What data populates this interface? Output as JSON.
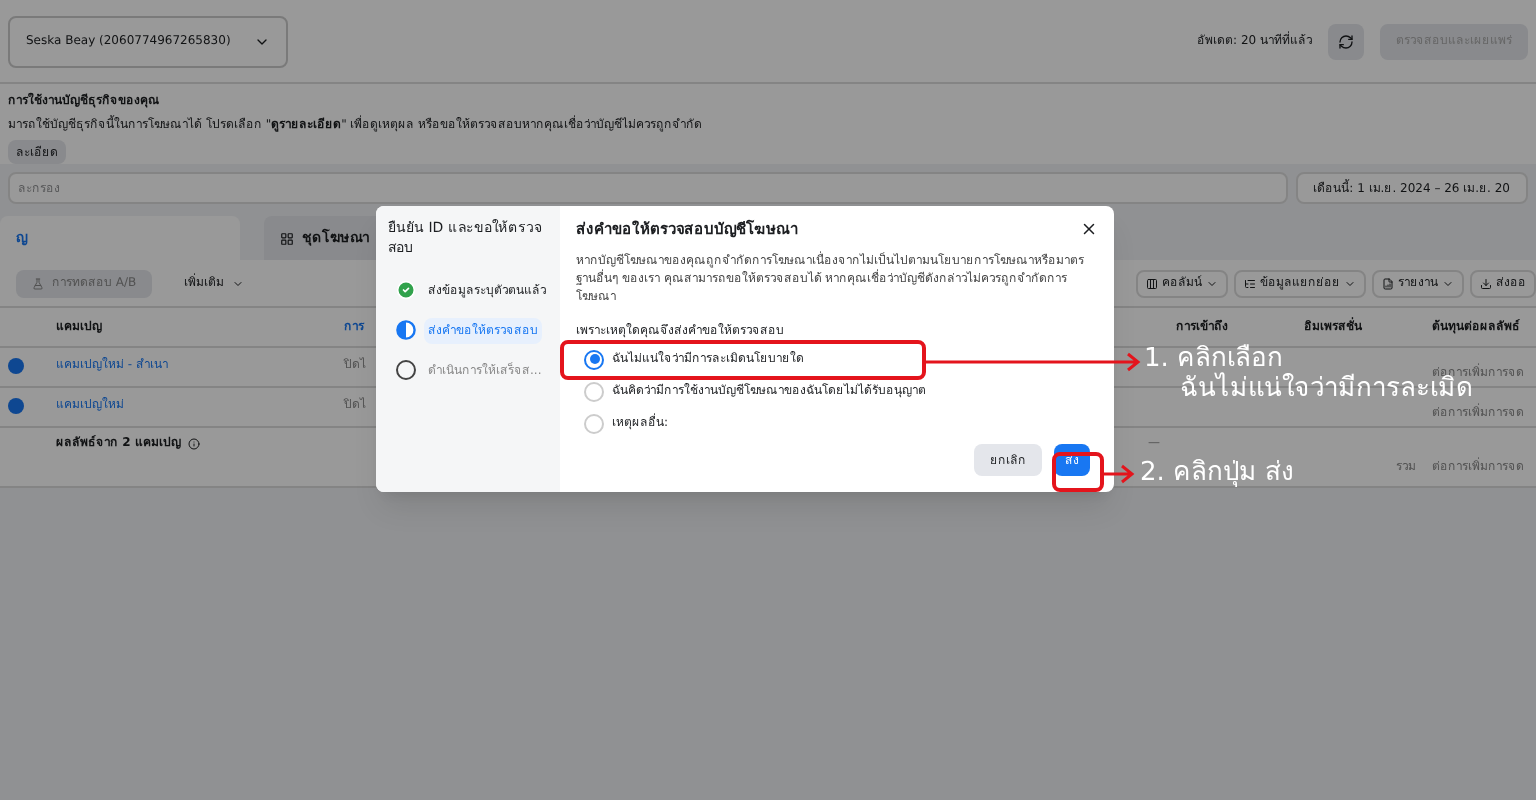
{
  "topbar": {
    "account": "Seska Beay (2060774967265830)",
    "updated": "อัพเดต: 20 นาทีที่แล้ว",
    "publish_button": "ตรวจสอบและเผยแพร่"
  },
  "banner": {
    "title": "การใช้งานบัญชีธุรกิจของคุณ",
    "text": "มารถใช้บัญชีธุรกิจนี้ในการโฆษณาได้ โปรดเลือก \"**ดูรายละเอียด**\" เพื่อดูเหตุผล หรือขอให้ตรวจสอบหากคุณเชื่อว่าบัญชีไม่ควรถูกจำกัด",
    "button": "ละเอียด"
  },
  "filter": {
    "placeholder": "ละกรอง",
    "date": "เดือนนี้: 1 เม.ย. 2024 – 26 เม.ย. 20"
  },
  "tabs": [
    {
      "label": "ญ",
      "selected": true
    },
    {
      "label": "ชุดโฆษณา",
      "selected": false
    }
  ],
  "toolbar_left": [
    "การทดสอบ A/B",
    "เพิ่มเติม"
  ],
  "toolbar_right": [
    "คอลัมน์",
    "ข้อมูลแยกย่อย",
    "รายงาน",
    "ส่งออ"
  ],
  "table": {
    "columns": [
      "แคมเปญ",
      "การ",
      "การเข้าถึง",
      "อิมเพรสชั่น",
      "ต้นทุนต่อผลลัพธ์"
    ],
    "rows": [
      {
        "name": "แคมเปญใหม่ - สำเนา",
        "status": "ปิดไ",
        "cost": "ต่อการเพิ่มการจด"
      },
      {
        "name": "แคมเปญใหม่",
        "status": "ปิดไ",
        "cost": "ต่อการเพิ่มการจด"
      }
    ],
    "footer": "ผลลัพธ์จาก 2 แคมเปญ",
    "footer_cells": [
      "—",
      "รวม",
      "ต่อการเพิ่มการจด"
    ]
  },
  "dialog": {
    "steps_title": "ยืนยัน ID และขอให้ตรวจสอบ",
    "steps": [
      {
        "label": "ส่งข้อมูลระบุตัวตนแล้ว",
        "kind": "done",
        "selected": false
      },
      {
        "label": "ส่งคำขอให้ตรวจสอบ",
        "kind": "current",
        "selected": true
      },
      {
        "label": "ดำเนินการให้เสร็จส...",
        "kind": "todo",
        "selected": false
      }
    ],
    "title": "ส่งคำขอให้ตรวจสอบบัญชีโฆษณา",
    "description": "หากบัญชีโฆษณาของคุณถูกจำกัดการโฆษณาเนื่องจากไม่เป็นไปตามนโยบายการโฆษณาหรือมาตรฐานอื่นๆ ของเรา คุณสามารถขอให้ตรวจสอบได้ หากคุณเชื่อว่าบัญชีดังกล่าวไม่ควรถูกจำกัดการโฆษณา",
    "question": "เพราะเหตุใดคุณจึงส่งคำขอให้ตรวจสอบ",
    "options": [
      {
        "label": "ฉันไม่แน่ใจว่ามีการละเมิดนโยบายใด",
        "selected": true
      },
      {
        "label": "ฉันคิดว่ามีการใช้งานบัญชีโฆษณาของฉันโดยไม่ได้รับอนุญาต",
        "selected": false
      },
      {
        "label": "เหตุผลอื่น:",
        "selected": false
      }
    ],
    "cancel": "ยกเลิก",
    "submit": "ส่ง"
  },
  "annotations": {
    "step1": "1. คลิกเลือก",
    "step1_detail": "ฉันไม่แน่ใจว่ามีการละเมิด",
    "step2": "2. คลิกปุ่ม ส่ง"
  }
}
